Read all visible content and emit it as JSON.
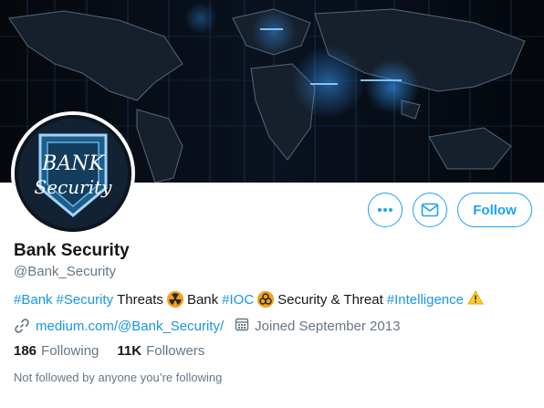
{
  "colors": {
    "accent": "#1da1f2",
    "link": "#1b95e0",
    "muted": "#657786",
    "text": "#14171a"
  },
  "banner": {
    "image": "dark world map with glowing blue network lights"
  },
  "avatar": {
    "logo_text_line1": "BANK",
    "logo_text_line2": "Security"
  },
  "actions": {
    "more_icon": "more-horizontal-icon",
    "message_icon": "envelope-icon",
    "follow_label": "Follow"
  },
  "profile": {
    "display_name": "Bank Security",
    "handle": "@Bank_Security"
  },
  "bio": {
    "tag_bank": "#Bank",
    "tag_security": "#Security",
    "text_threats": "Threats",
    "emoji_1": "radioactive-emoji",
    "text_bank": "Bank",
    "tag_ioc": "#IOC",
    "emoji_2": "biohazard-emoji",
    "text_security_threat": "Security & Threat",
    "tag_intelligence": "#Intelligence",
    "emoji_3": "warning-emoji"
  },
  "meta": {
    "link_icon": "link-icon",
    "website": "medium.com/@Bank_Security/",
    "calendar_icon": "calendar-icon",
    "joined": "Joined September 2013"
  },
  "stats": {
    "following_count": "186",
    "following_label": "Following",
    "followers_count": "11K",
    "followers_label": "Followers"
  },
  "not_followed_text": "Not followed by anyone you’re following"
}
